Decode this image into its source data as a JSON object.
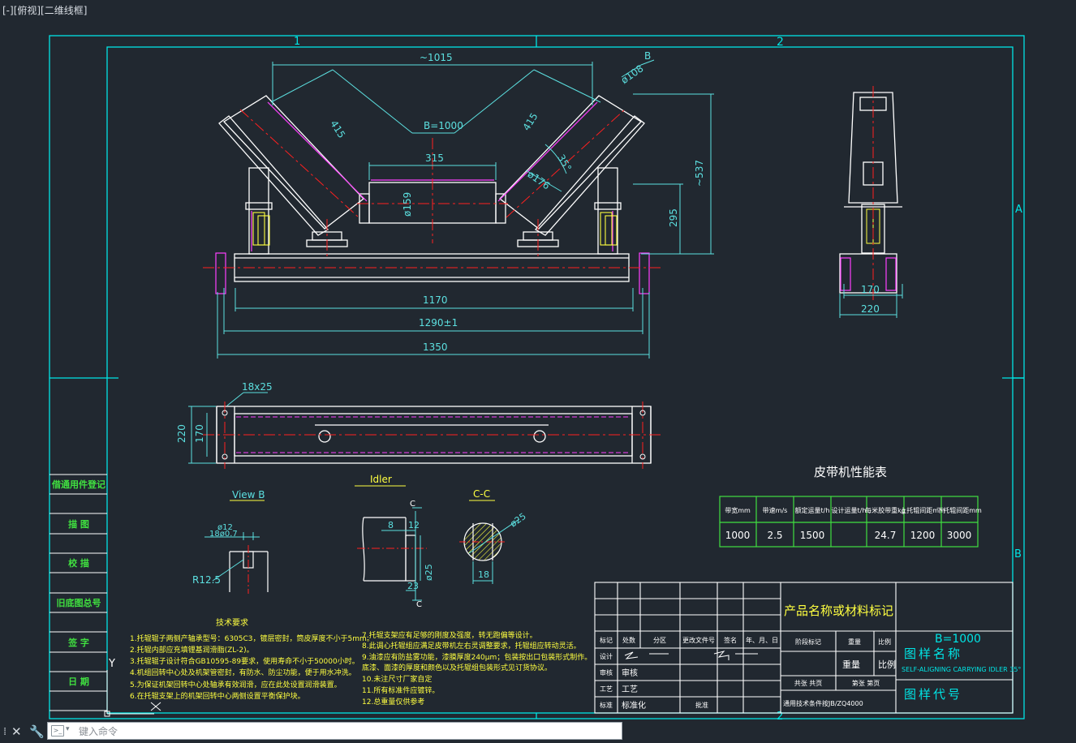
{
  "viewport": {
    "label": "[-][俯视][二维线框]"
  },
  "colors": {
    "background": "#212830",
    "frame": "#00e5e5",
    "geometry": "#ffffff",
    "center": "#ff2020",
    "dims": "#5ce0e0",
    "text": "#ffff40",
    "green": "#40e040",
    "magenta": "#ff40ff"
  },
  "border": {
    "cols": [
      "1",
      "2"
    ],
    "rows": [
      "A",
      "B"
    ]
  },
  "front_view": {
    "overall": "~1015",
    "belt": "B=1000",
    "roll_len_left": "415",
    "roll_len_right": "415",
    "dia_roll": "ø108",
    "view_b": "B",
    "angle": "35°",
    "dia_176": "ø176",
    "center_len": "315",
    "dia_159": "ø159",
    "h537": "~537",
    "h295": "295",
    "w1170": "1170",
    "w1290": "1290±1",
    "w1350": "1350"
  },
  "side_view": {
    "w170": "170",
    "w220": "220"
  },
  "plan_view": {
    "slot": "18x25",
    "w220": "220",
    "w170": "170"
  },
  "details": {
    "view_b_title": "View B",
    "d12": "ø12",
    "d18": "18ø0.7",
    "r": "R12.5",
    "idler_title": "Idler",
    "c1": "C",
    "c2": "C",
    "d8": "8",
    "d12b": "12",
    "d23": "23",
    "d25": "ø25",
    "cc_title": "C-C",
    "cc_d25": "ø25",
    "cc_18": "18"
  },
  "tech": {
    "title": "技术要求",
    "left": [
      "1.托辊辊子两侧产轴承型号：6305C3，镀层密封，筒皮厚度不小于5mm。",
      "2.托辊内部应充填锂基润滑脂(ZL-2)。",
      "3.托辊辊子设计符合GB10595-89要求，使用寿命不小于50000小时。",
      "4.机组回转中心处及机架管密封，有防水、防尘功能，便于用水冲洗。",
      "5.为保证机架回转中心处轴承有效润滑，应在此处设置润滑装置。",
      "6.在托辊支架上的机架回转中心两侧设置平衡保护块。"
    ],
    "right": [
      "7.托辊支架应有足够的刚度及强度，转无跑偏等设计。",
      "8.此调心托辊组应满足皮带机左右灵调整要求，托辊组应转动灵活。",
      "9.油漆应有防盐雾功能，漆膜厚度240μm；包装按出口包装形式制作。",
      "  底漆、面漆的厚度和颜色以及托辊组包装形式见订货协议。",
      "10.未注尺寸厂家自定",
      "11.所有标准件应镀锌。",
      "12.总重量仅供参考"
    ]
  },
  "perf": {
    "title": "皮带机性能表",
    "headers": [
      "带宽mm",
      "带速m/s",
      "额定运量t/h",
      "设计运量t/h",
      "每米胶带重kg",
      "上托辊间距mm",
      "下托辊间距mm"
    ],
    "values": [
      "1000",
      "2.5",
      "1500",
      "",
      "24.7",
      "1200",
      "3000"
    ]
  },
  "side_panel": [
    "借通用件登记",
    "描  图",
    "校  描",
    "旧底图总号",
    "签  字",
    "日  期"
  ],
  "title_block": {
    "product": "产品名称或材料标记",
    "heads": [
      "标记",
      "处数",
      "分区",
      "更改文件号",
      "签名",
      "年、月、日"
    ],
    "roles": [
      "设计",
      "审核",
      "工艺",
      "标准"
    ],
    "role_vals": [
      "",
      "审核",
      "工艺",
      "标准化"
    ],
    "pizhun": "批准",
    "stage": "阶段标记",
    "weight": "重量",
    "scale": "比例",
    "zhong": "重量",
    "bili": "比例",
    "total": "共张 共页",
    "page": "第张 第页",
    "std": "通用技术条件按JB/ZQ4000",
    "b": "B=1000",
    "name": "图样名称",
    "name_en": "SELF-ALIGNING CARRYING IDLER 35°",
    "code": "图样代号"
  },
  "command": {
    "placeholder": "键入命令"
  }
}
